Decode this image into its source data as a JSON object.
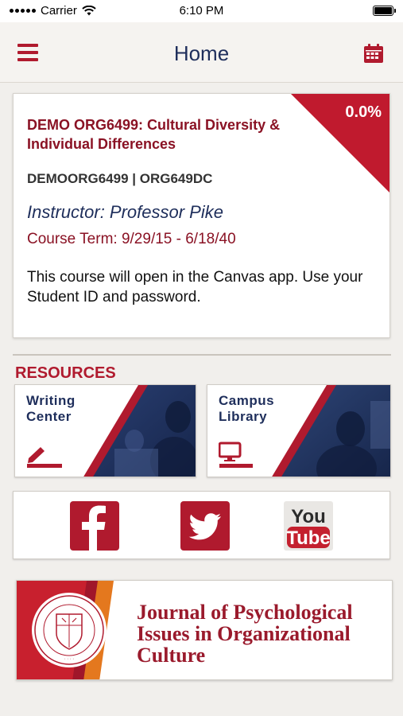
{
  "status_bar": {
    "carrier": "Carrier",
    "time": "6:10 PM"
  },
  "nav": {
    "title": "Home",
    "menu_icon": "hamburger-menu-icon",
    "calendar_icon": "calendar-icon"
  },
  "course": {
    "progress": "0.0%",
    "title": "DEMO ORG6499: Cultural Diversity & Individual Differences",
    "code": "DEMOORG6499 | ORG649DC",
    "instructor": "Instructor: Professor  Pike",
    "term": "Course Term: 9/29/15 - 6/18/40",
    "note": "This course will open in the Canvas app. Use your Student ID and password."
  },
  "resources": {
    "heading": "RESOURCES",
    "tiles": [
      {
        "label": "Writing Center",
        "icon": "pencil-icon"
      },
      {
        "label": "Campus Library",
        "icon": "computer-icon"
      }
    ]
  },
  "social": [
    {
      "name": "facebook",
      "icon": "facebook-icon"
    },
    {
      "name": "twitter",
      "icon": "twitter-icon"
    },
    {
      "name": "youtube",
      "icon": "youtube-icon",
      "text_top": "You",
      "text_bottom": "Tube"
    }
  ],
  "journal": {
    "title": "Journal of Psychological Issues in Organizational Culture"
  },
  "colors": {
    "brand_red": "#b01a2e",
    "dark_red": "#8a1224",
    "navy": "#1e2e5b",
    "background": "#f1efec"
  }
}
